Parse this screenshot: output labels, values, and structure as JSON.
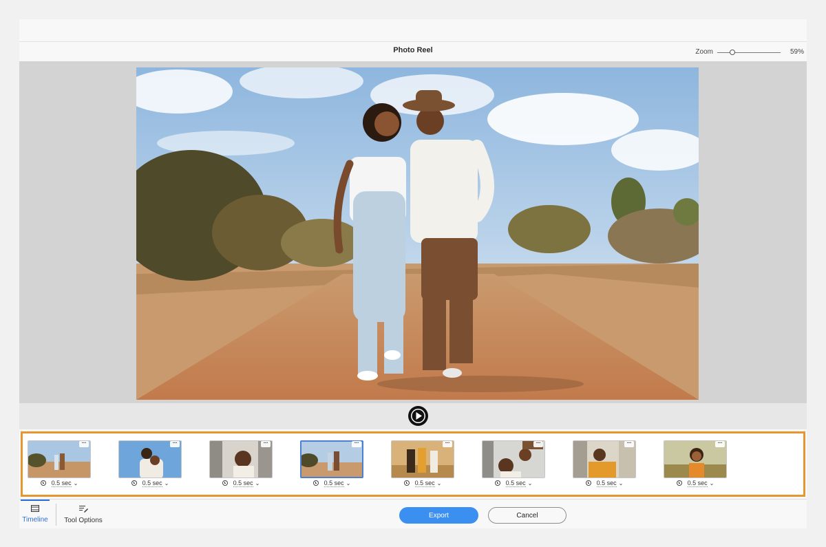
{
  "window": {
    "title": "Photo Reel",
    "zoom": {
      "label": "Zoom",
      "value": "59%",
      "level_percent": 59
    }
  },
  "preview": {
    "image": "couple-walking-dirt-road-photo",
    "play_icon": "play-icon"
  },
  "timeline": {
    "clips": [
      {
        "scene": "couple-on-dirt-road",
        "duration": "0.5 sec",
        "selected": false
      },
      {
        "scene": "couple-piggyback-blue-sky",
        "duration": "0.5 sec",
        "selected": false
      },
      {
        "scene": "woman-in-car-window",
        "duration": "0.5 sec",
        "selected": false
      },
      {
        "scene": "couple-walking-road",
        "duration": "0.5 sec",
        "selected": true
      },
      {
        "scene": "couple-at-sunset",
        "duration": "0.5 sec",
        "selected": false
      },
      {
        "scene": "couple-in-van",
        "duration": "0.5 sec",
        "selected": false
      },
      {
        "scene": "woman-in-van-doorway",
        "duration": "0.5 sec",
        "selected": false
      },
      {
        "scene": "woman-smiling-field",
        "duration": "0.5 sec",
        "selected": false
      }
    ],
    "more_label": "···"
  },
  "bottom_bar": {
    "tabs": [
      {
        "label": "Timeline",
        "icon": "filmstrip-icon",
        "active": true
      },
      {
        "label": "Tool Options",
        "icon": "tool-options-icon",
        "active": false
      }
    ],
    "export_label": "Export",
    "cancel_label": "Cancel"
  },
  "colors": {
    "accent": "#3b8ff0",
    "timeline_highlight": "#e6962f",
    "selected_thumb_border": "#4a7fd2"
  }
}
